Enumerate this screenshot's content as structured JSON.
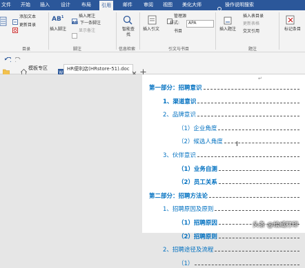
{
  "ribbon_tabs": [
    "文件",
    "开始",
    "插入",
    "设计",
    "布局",
    "引用",
    "邮件",
    "审阅",
    "视图",
    "美化大师",
    "操作说明搜索"
  ],
  "active_tab": "引用",
  "ribbon": {
    "toc_label": "目录",
    "add_text": "添加文本",
    "update_toc": "更新目录",
    "insert_footnote": "插入脚注",
    "insert_endnote": "插入尾注",
    "next_footnote": "下一条脚注",
    "show_notes": "显示备注",
    "footnote_group": "脚注",
    "smart_lookup": "智能查找",
    "info_group": "信息检索",
    "insert_citation": "插入引文",
    "manage_sources": "管理源",
    "style_label": "样式:",
    "style_value": "APA",
    "bibliography": "书目",
    "citations_group": "引文与书目",
    "insert_caption": "插入题注",
    "insert_table_of_figures": "插入表目录",
    "update_table": "更新表格",
    "cross_reference": "交叉引用",
    "captions_group": "题注",
    "mark_entry": "标记条目"
  },
  "doc_tabs": [
    "模板专区",
    "HR便利店(HRstore-51).doc"
  ],
  "toc": [
    {
      "text": "第一部分：招聘意识",
      "level": 0,
      "bold": true
    },
    {
      "text": "1、渠道意识",
      "level": 1,
      "bold": true
    },
    {
      "text": "2、品牌意识",
      "level": 1,
      "bold": false
    },
    {
      "text": "（1）企业角度",
      "level": 2,
      "bold": false
    },
    {
      "text": "（2）候选人角度",
      "level": 2,
      "bold": false
    },
    {
      "text": "3、伙伴意识",
      "level": 1,
      "bold": false
    },
    {
      "text": "（1）业务自测",
      "level": 2,
      "bold": true
    },
    {
      "text": "（2）员工关系",
      "level": 2,
      "bold": true
    },
    {
      "text": "第二部分：招聘方法论",
      "level": 0,
      "bold": true
    },
    {
      "text": "1、招聘原因及原则",
      "level": 1,
      "bold": false
    },
    {
      "text": "（1）招聘原因",
      "level": 2,
      "bold": true
    },
    {
      "text": "（2）招聘原则",
      "level": 2,
      "bold": true
    },
    {
      "text": "2、招聘途径及流程",
      "level": 1,
      "bold": false
    },
    {
      "text": "（1）",
      "level": 2,
      "bold": false
    }
  ],
  "watermark": "头条 @绘威打印",
  "colors": {
    "ribbon_blue": "#2b579a",
    "toc_blue": "#0070c0"
  }
}
